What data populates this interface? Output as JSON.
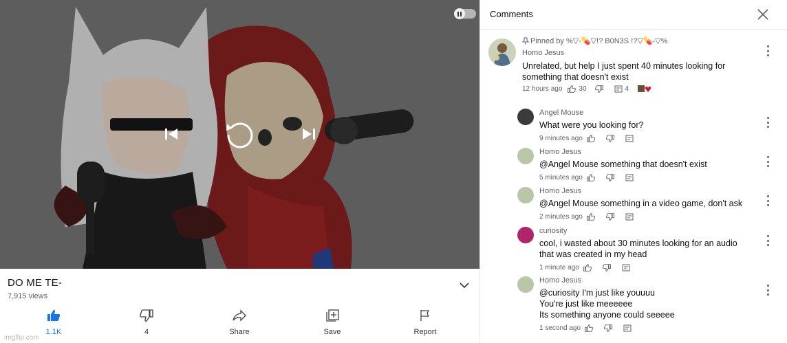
{
  "video": {
    "title": "DO ME TE-",
    "views": "7,915 views",
    "actions": [
      {
        "label": "1.1K",
        "icon": "thumbs-up-filled-icon"
      },
      {
        "label": "4",
        "icon": "thumbs-down-icon"
      },
      {
        "label": "Share",
        "icon": "share-icon"
      },
      {
        "label": "Save",
        "icon": "save-playlist-icon"
      },
      {
        "label": "Report",
        "icon": "flag-icon"
      }
    ]
  },
  "comments_panel": {
    "title": "Comments",
    "pinned": {
      "pinned_label": "Pinned by %▽-💊▽!? B0N3S !?▽💊-▽%",
      "author": "Homo Jesus",
      "text_line1": "Unrelated, but help I just spent 40 minutes looking for",
      "text_line2": "something that doesn't exist",
      "time": "12 hours ago",
      "likes": "30",
      "replies": "4"
    },
    "replies": [
      {
        "author": "Angel Mouse",
        "lines": [
          "What were you looking for?"
        ],
        "time": "9 minutes ago",
        "avatar_color": "#3b3b3b"
      },
      {
        "author": "Homo Jesus",
        "lines": [
          "@Angel Mouse  something that doesn't exist"
        ],
        "time": "5 minutes ago",
        "avatar_color": "#b9c7a8"
      },
      {
        "author": "Homo Jesus",
        "lines": [
          "@Angel Mouse  something in a video game, don't ask"
        ],
        "time": "2 minutes ago",
        "avatar_color": "#b9c7a8"
      },
      {
        "author": "curiosity",
        "lines": [
          "cool, i wasted about 30 minutes looking for an audio",
          "that was created in my head"
        ],
        "time": "1 minute ago",
        "avatar_color": "#b0256a"
      },
      {
        "author": "Homo Jesus",
        "lines": [
          "@curiosity  I'm just like youuuu",
          "You're just like meeeeee",
          "Its something anyone could seeeee"
        ],
        "time": "1 second ago",
        "avatar_color": "#b9c7a8"
      }
    ]
  },
  "watermark": "imgflip.com"
}
